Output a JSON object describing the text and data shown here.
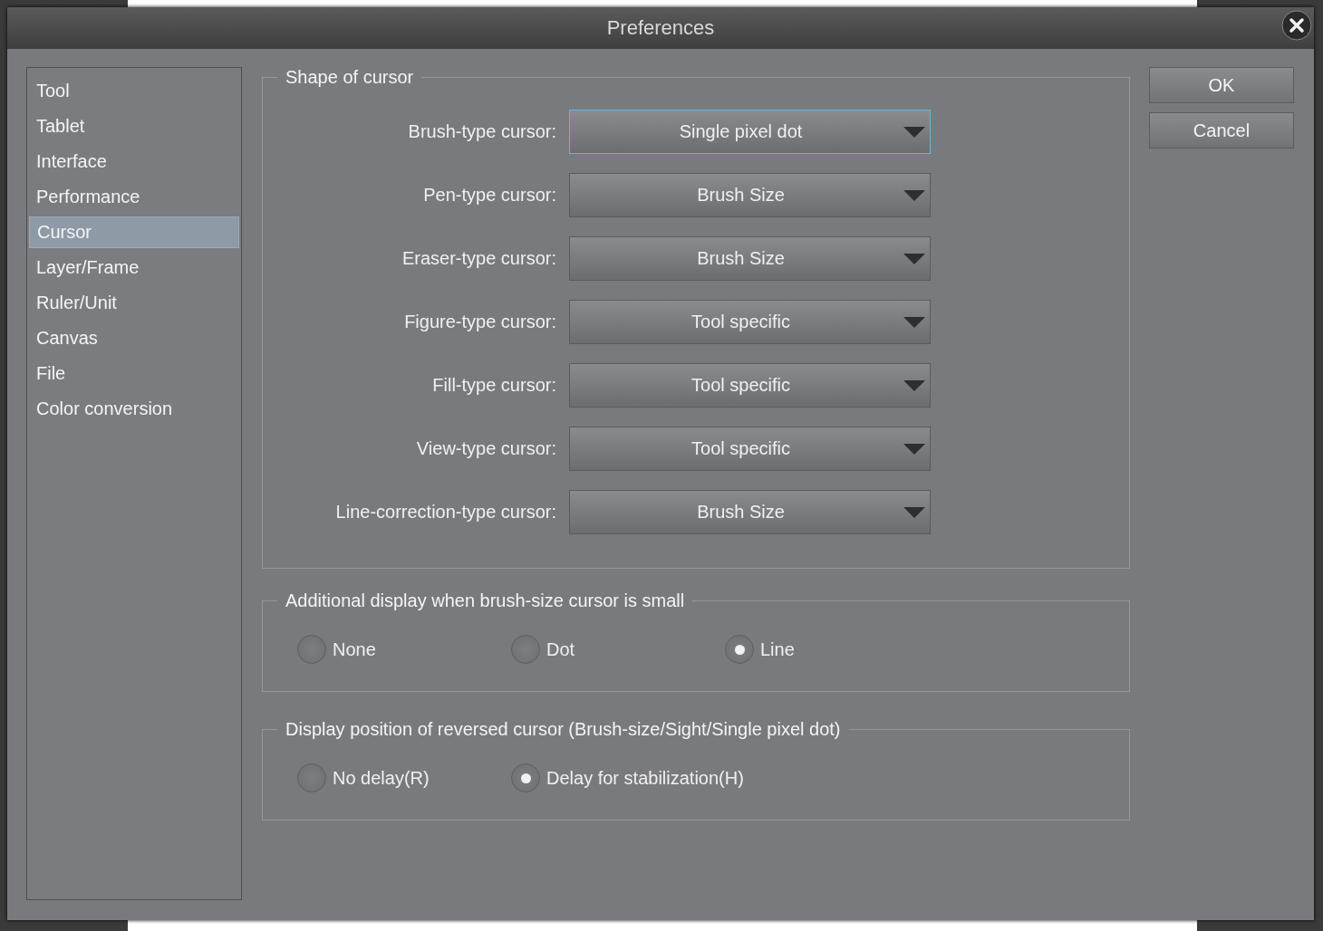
{
  "window": {
    "title": "Preferences"
  },
  "sidebar": {
    "items": [
      {
        "label": "Tool",
        "selected": false
      },
      {
        "label": "Tablet",
        "selected": false
      },
      {
        "label": "Interface",
        "selected": false
      },
      {
        "label": "Performance",
        "selected": false
      },
      {
        "label": "Cursor",
        "selected": true
      },
      {
        "label": "Layer/Frame",
        "selected": false
      },
      {
        "label": "Ruler/Unit",
        "selected": false
      },
      {
        "label": "Canvas",
        "selected": false
      },
      {
        "label": "File",
        "selected": false
      },
      {
        "label": "Color conversion",
        "selected": false
      }
    ]
  },
  "cursor_shape": {
    "title": "Shape of cursor",
    "rows": [
      {
        "label": "Brush-type cursor:",
        "value": "Single pixel dot",
        "focused": true
      },
      {
        "label": "Pen-type cursor:",
        "value": "Brush Size",
        "focused": false
      },
      {
        "label": "Eraser-type cursor:",
        "value": "Brush Size",
        "focused": false
      },
      {
        "label": "Figure-type cursor:",
        "value": "Tool specific",
        "focused": false
      },
      {
        "label": "Fill-type cursor:",
        "value": "Tool specific",
        "focused": false
      },
      {
        "label": "View-type cursor:",
        "value": "Tool specific",
        "focused": false
      },
      {
        "label": "Line-correction-type cursor:",
        "value": "Brush Size",
        "focused": false
      }
    ]
  },
  "radio_groups": [
    {
      "title": "Additional display when brush-size cursor is small",
      "options": [
        {
          "label": "None",
          "selected": false
        },
        {
          "label": "Dot",
          "selected": false
        },
        {
          "label": "Line",
          "selected": true
        }
      ]
    },
    {
      "title": "Display position of reversed cursor (Brush-size/Sight/Single pixel dot)",
      "options": [
        {
          "label": "No delay(R)",
          "selected": false
        },
        {
          "label": "Delay for stabilization(H)",
          "selected": true
        }
      ]
    }
  ],
  "buttons": [
    "OK",
    "Cancel"
  ]
}
